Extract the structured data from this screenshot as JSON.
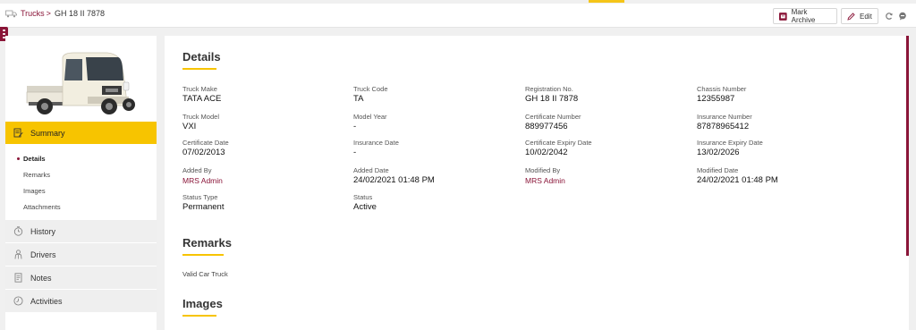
{
  "breadcrumb": {
    "parent": "Trucks",
    "separator": ">",
    "current": "GH 18 II 7878"
  },
  "header": {
    "archive_label": "Mark Archive",
    "edit_label": "Edit"
  },
  "sidebar": {
    "summary_label": "Summary",
    "subitems": [
      "Details",
      "Remarks",
      "Images",
      "Attachments"
    ],
    "items": [
      "History",
      "Drivers",
      "Notes",
      "Activities"
    ]
  },
  "details": {
    "title": "Details",
    "rows": [
      [
        {
          "label": "Truck Make",
          "value": "TATA ACE"
        },
        {
          "label": "Truck Code",
          "value": "TA"
        },
        {
          "label": "Registration No.",
          "value": "GH 18 II 7878"
        },
        {
          "label": "Chassis Number",
          "value": "12355987"
        }
      ],
      [
        {
          "label": "Truck Model",
          "value": "VXI"
        },
        {
          "label": "Model Year",
          "value": "-"
        },
        {
          "label": "Certificate Number",
          "value": "889977456"
        },
        {
          "label": "Insurance Number",
          "value": "87878965412"
        }
      ],
      [
        {
          "label": "Certificate Date",
          "value": "07/02/2013"
        },
        {
          "label": "Insurance Date",
          "value": "-"
        },
        {
          "label": "Certificate Expiry Date",
          "value": "10/02/2042"
        },
        {
          "label": "Insurance Expiry Date",
          "value": "13/02/2026"
        }
      ],
      [
        {
          "label": "Added By",
          "value": "MRS Admin"
        },
        {
          "label": "Added Date",
          "value": "24/02/2021 01:48 PM"
        },
        {
          "label": "Modified By",
          "value": "MRS Admin"
        },
        {
          "label": "Modified Date",
          "value": "24/02/2021 01:48 PM"
        }
      ],
      [
        {
          "label": "Status Type",
          "value": "Permanent"
        },
        {
          "label": "Status",
          "value": "Active"
        }
      ]
    ]
  },
  "remarks": {
    "title": "Remarks",
    "text": "Valid Car Truck"
  },
  "images": {
    "title": "Images"
  },
  "colors": {
    "accent": "#8a1538",
    "highlight": "#f7c400"
  }
}
